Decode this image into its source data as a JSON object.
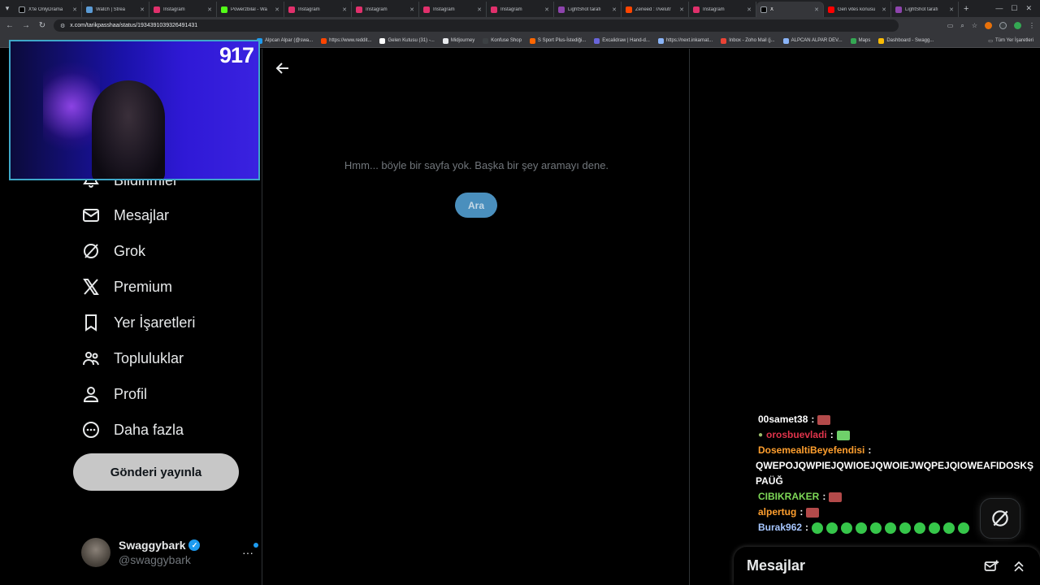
{
  "browser": {
    "tabs": [
      {
        "label": "X'te OnlyDrama",
        "color": "#000000"
      },
      {
        "label": "Watch | Strea",
        "color": "#5b9bd5"
      },
      {
        "label": "Instagram",
        "color": "#e1306c"
      },
      {
        "label": "Powerzbilal - Wa",
        "color": "#53fc18"
      },
      {
        "label": "Instagram",
        "color": "#e1306c"
      },
      {
        "label": "Instagram",
        "color": "#e1306c"
      },
      {
        "label": "Instagram",
        "color": "#e1306c"
      },
      {
        "label": "Instagram",
        "color": "#e1306c"
      },
      {
        "label": "LightShot tarafı",
        "color": "#8e44ad"
      },
      {
        "label": "Zeneed : r/velutr",
        "color": "#ff4500"
      },
      {
        "label": "Instagram",
        "color": "#e1306c"
      },
      {
        "label": "X",
        "color": "#000000",
        "active": true
      },
      {
        "label": "Geri vites konusu",
        "color": "#ff0000"
      },
      {
        "label": "LightShot tarafı",
        "color": "#8e44ad"
      }
    ],
    "url": "x.com/tarikpasshaa/status/1934391039326491431",
    "bookmarks": [
      "Alpcan Alpar (@swa...",
      "https://www.reddit...",
      "Gelen Kutusu (31) -...",
      "Midjourney",
      "Konfuse Shop",
      "S Sport Plus-İstediği...",
      "Excalidraw | Hand-d...",
      "https://next.inkarnat...",
      "Inbox - Zoho Mail (j...",
      "ALPCAN ALPAR DEV...",
      "Maps",
      "Dashboard - Swagg..."
    ],
    "all_bookmarks": "Tüm Yer İşaretleri"
  },
  "webcam": {
    "counter": "917"
  },
  "nav": {
    "items": [
      {
        "label": "Bildirimler",
        "icon": "bell-icon"
      },
      {
        "label": "Mesajlar",
        "icon": "mail-icon"
      },
      {
        "label": "Grok",
        "icon": "grok-icon"
      },
      {
        "label": "Premium",
        "icon": "x-logo-icon"
      },
      {
        "label": "Yer İşaretleri",
        "icon": "bookmark-icon"
      },
      {
        "label": "Topluluklar",
        "icon": "communities-icon"
      },
      {
        "label": "Profil",
        "icon": "profile-icon"
      },
      {
        "label": "Daha fazla",
        "icon": "more-circle-icon"
      }
    ],
    "post_button": "Gönderi yayınla"
  },
  "account": {
    "name": "Swaggybark",
    "handle": "@swaggybark",
    "more": "···"
  },
  "main": {
    "not_found_text": "Hmm... böyle bir sayfa yok. Başka bir şey aramayı dene.",
    "search_button": "Ara"
  },
  "chat": {
    "lines": [
      {
        "user": "00samet38",
        "color": "#ffffff",
        "emote": "#b34a4a"
      },
      {
        "user": "orosbuevladi",
        "color": "#e0344b",
        "emote": "#6fd16a"
      },
      {
        "user": "DosemealtiBeyefendisi",
        "color": "#ff9f2e",
        "message": "QWEPOJQWPIEJQWIOEJQWOIEJWQPEJQIOWEAFIDOSKŞPAÜĞ"
      },
      {
        "user": "CIBIKRAKER",
        "color": "#7ed957",
        "emote": "#b34a4a"
      },
      {
        "user": "alpertug",
        "color": "#ff9f2e",
        "emote": "#b34a4a"
      },
      {
        "user": "Burak962",
        "color": "#a7c7ff",
        "gemotes": 11
      }
    ]
  },
  "messages_drawer": {
    "title": "Mesajlar"
  }
}
